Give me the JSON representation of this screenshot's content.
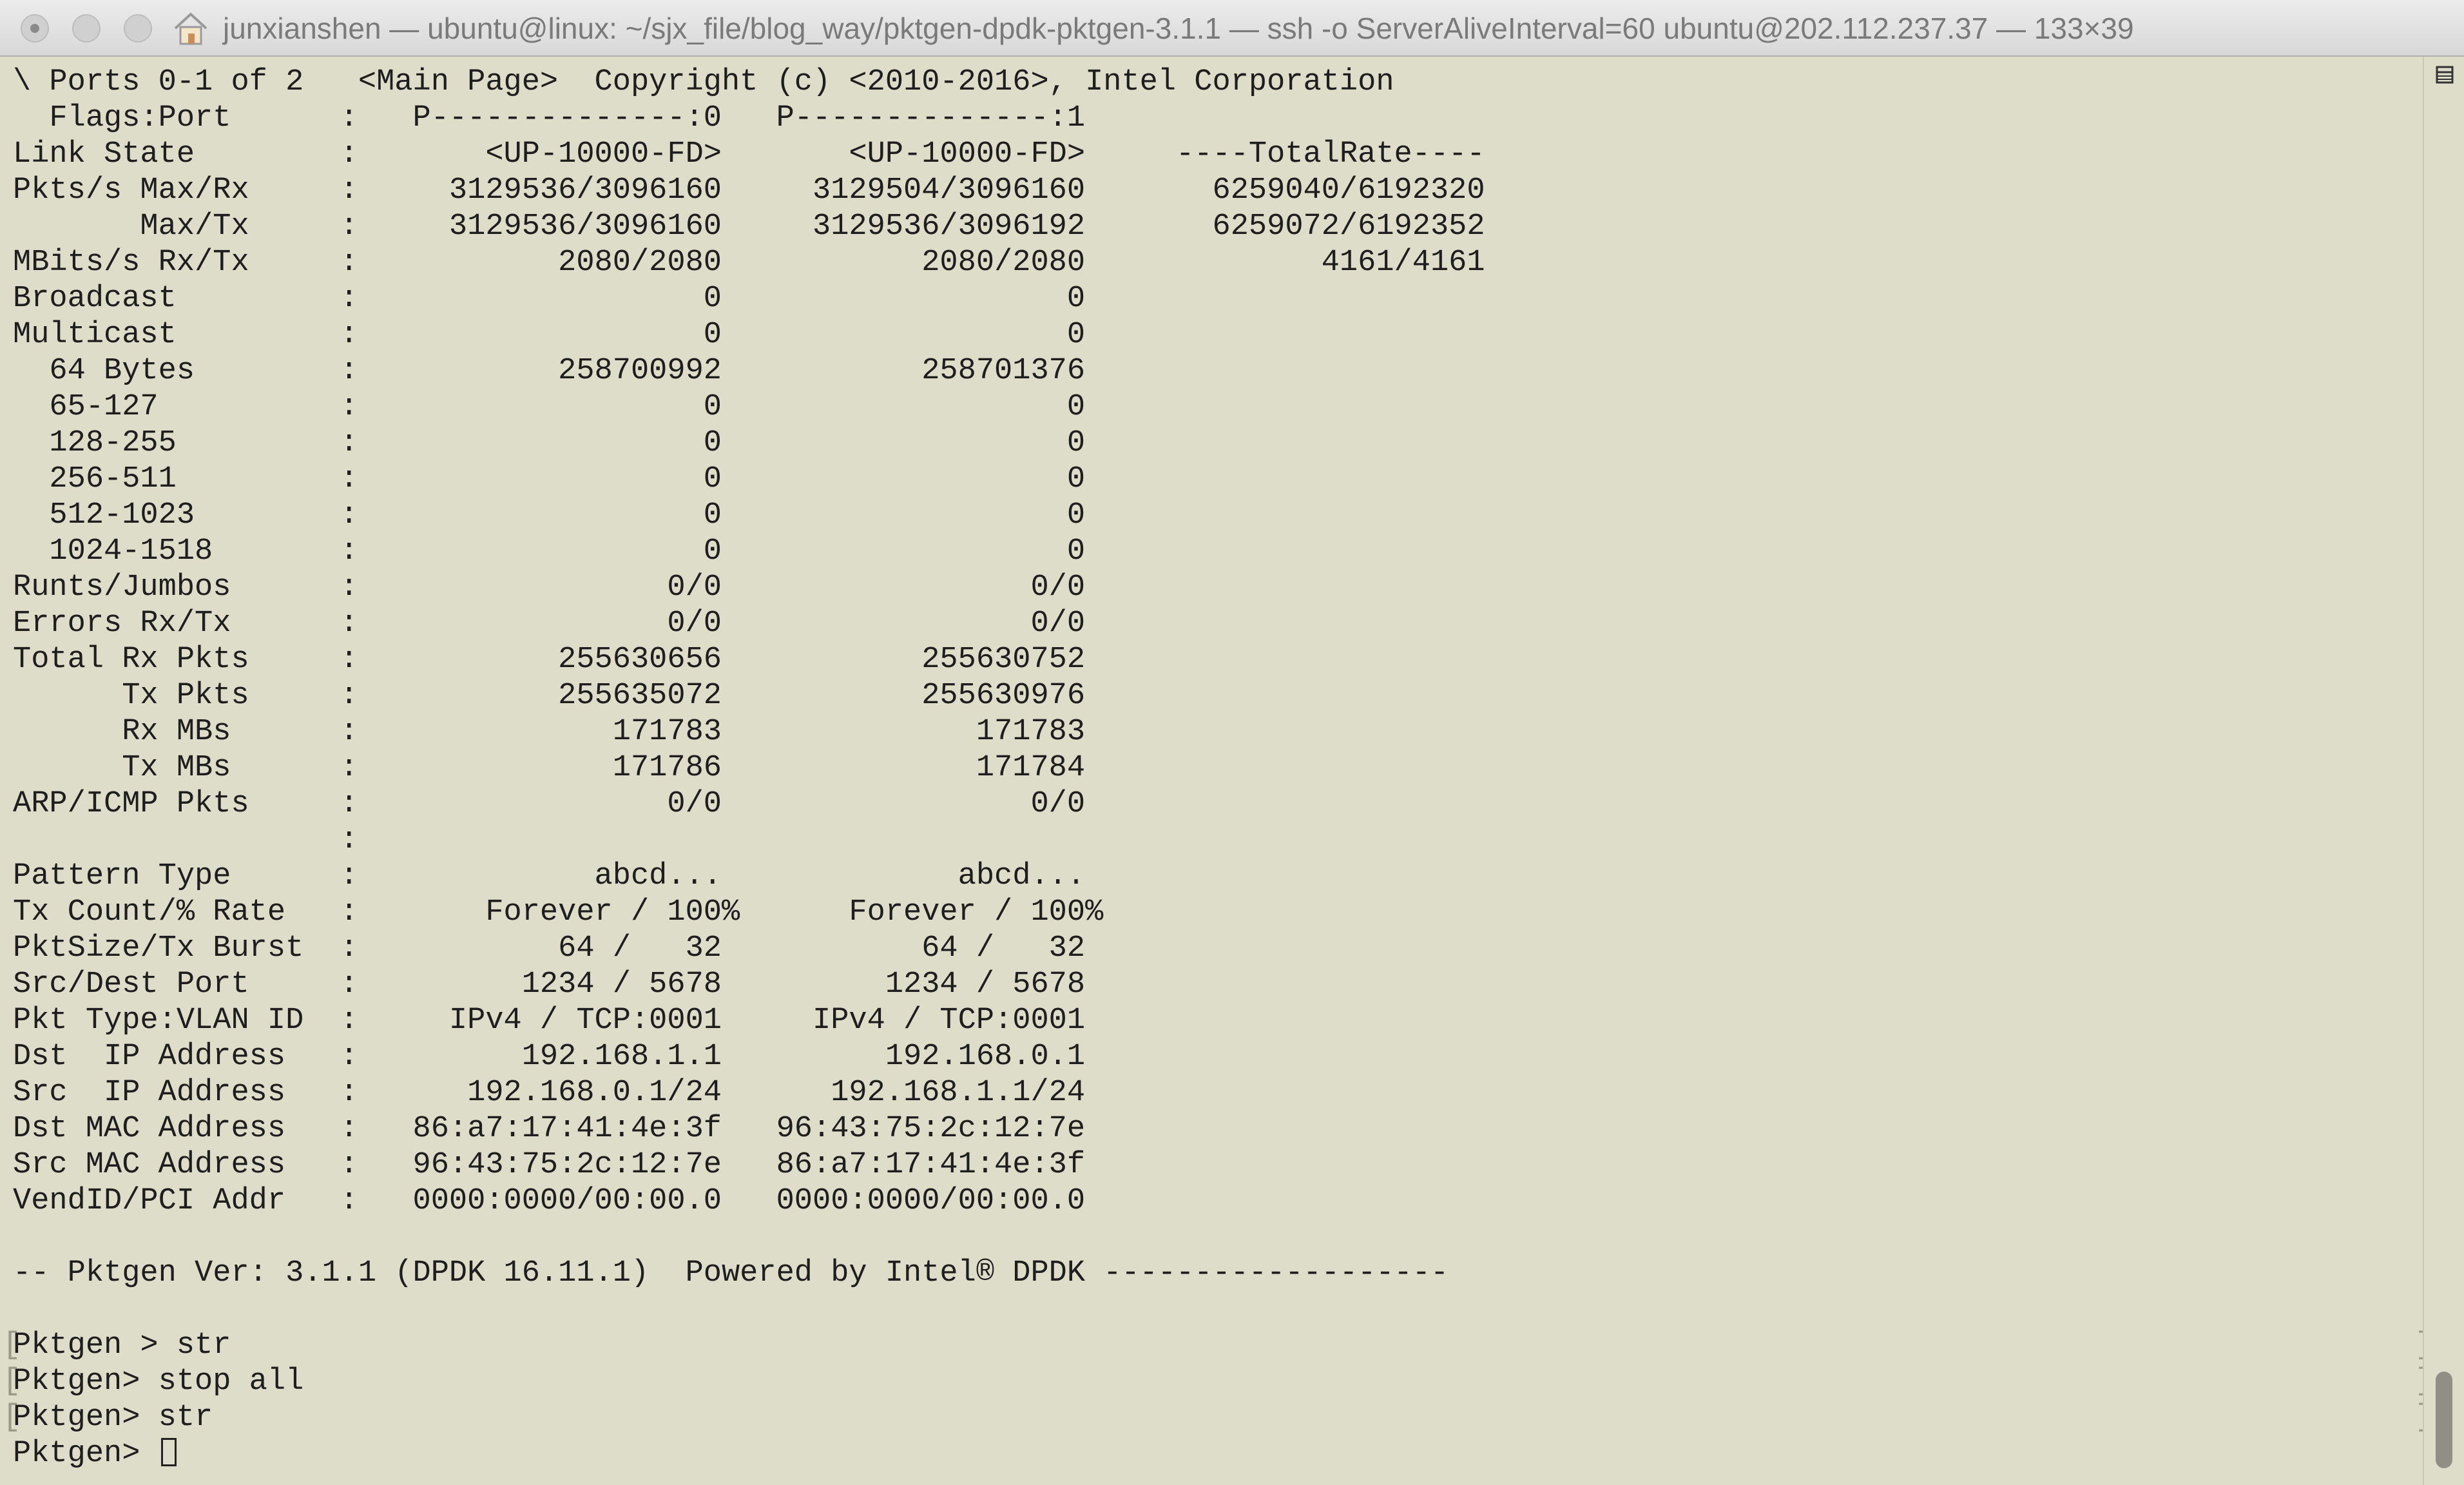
{
  "window": {
    "title": "junxianshen — ubuntu@linux: ~/sjx_file/blog_way/pktgen-dpdk-pktgen-3.1.1 — ssh -o ServerAliveInterval=60 ubuntu@202.112.237.37 — 133×39"
  },
  "icons": {
    "home": "home-icon",
    "close": "close-icon",
    "minimize": "minimize-icon",
    "zoom": "zoom-icon",
    "scroll_menu": "list-icon"
  },
  "terminal": {
    "lines": [
      "\\ Ports 0-1 of 2   <Main Page>  Copyright (c) <2010-2016>, Intel Corporation",
      "  Flags:Port      :   P--------------:0   P--------------:1",
      "Link State        :       <UP-10000-FD>       <UP-10000-FD>     ----TotalRate----",
      "Pkts/s Max/Rx     :     3129536/3096160     3129504/3096160       6259040/6192320",
      "       Max/Tx     :     3129536/3096160     3129536/3096192       6259072/6192352",
      "MBits/s Rx/Tx     :           2080/2080           2080/2080             4161/4161",
      "Broadcast         :                   0                   0",
      "Multicast         :                   0                   0",
      "  64 Bytes        :           258700992           258701376",
      "  65-127          :                   0                   0",
      "  128-255         :                   0                   0",
      "  256-511         :                   0                   0",
      "  512-1023        :                   0                   0",
      "  1024-1518       :                   0                   0",
      "Runts/Jumbos      :                 0/0                 0/0",
      "Errors Rx/Tx      :                 0/0                 0/0",
      "Total Rx Pkts     :           255630656           255630752",
      "      Tx Pkts     :           255635072           255630976",
      "      Rx MBs      :              171783              171783",
      "      Tx MBs      :              171786              171784",
      "ARP/ICMP Pkts     :                 0/0                 0/0",
      "                  :",
      "Pattern Type      :             abcd...             abcd...",
      "Tx Count/% Rate   :       Forever / 100%      Forever / 100%",
      "PktSize/Tx Burst  :           64 /   32           64 /   32",
      "Src/Dest Port     :         1234 / 5678         1234 / 5678",
      "Pkt Type:VLAN ID  :     IPv4 / TCP:0001     IPv4 / TCP:0001",
      "Dst  IP Address   :         192.168.1.1         192.168.0.1",
      "Src  IP Address   :      192.168.0.1/24      192.168.1.1/24",
      "Dst MAC Address   :   86:a7:17:41:4e:3f   96:43:75:2c:12:7e",
      "Src MAC Address   :   96:43:75:2c:12:7e   86:a7:17:41:4e:3f",
      "VendID/PCI Addr   :   0000:0000/00:00.0   0000:0000/00:00.0",
      "",
      "-- Pktgen Ver: 3.1.1 (DPDK 16.11.1)  Powered by Intel® DPDK -------------------",
      ""
    ],
    "prompts": [
      "Pktgen > str",
      "Pktgen> stop all",
      "Pktgen> str",
      "Pktgen> "
    ]
  }
}
